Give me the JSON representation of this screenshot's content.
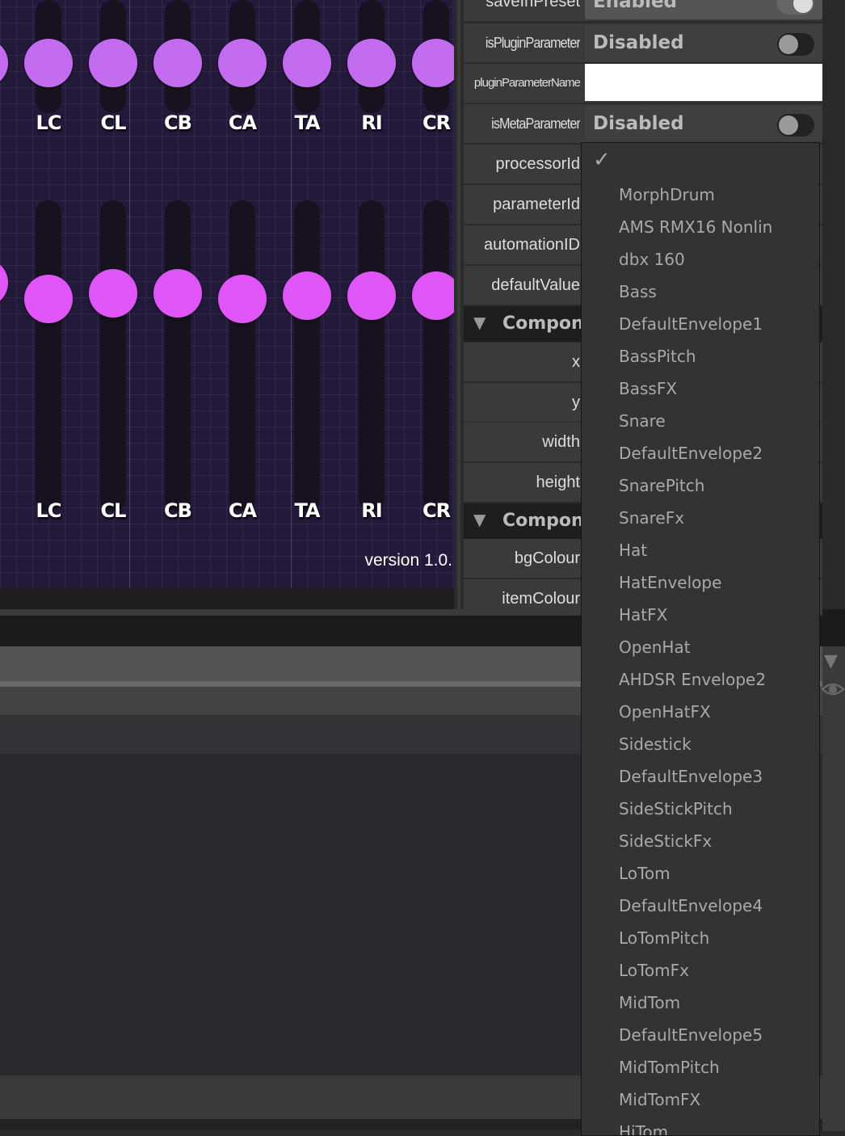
{
  "canvas": {
    "knob_colors": {
      "top": "#c46cf0",
      "bottom": "#e055f8"
    },
    "top_row": {
      "labels": [
        "LC",
        "CL",
        "CB",
        "CA",
        "TA",
        "RI",
        "CR"
      ]
    },
    "bottom_row": {
      "labels": [
        "LC",
        "CL",
        "CB",
        "CA",
        "TA",
        "RI",
        "CR"
      ],
      "values": [
        0.72,
        0.74,
        0.74,
        0.72,
        0.73,
        0.73,
        0.73
      ]
    },
    "version": "version 1.0."
  },
  "properties": {
    "saveInPreset": {
      "label": "saveInPreset",
      "value": "Enabled"
    },
    "isPluginParameter": {
      "label": "isPluginParameter",
      "value": "Disabled"
    },
    "pluginParameterName": {
      "label": "pluginParameterName",
      "value": ""
    },
    "isMetaParameter": {
      "label": "isMetaParameter",
      "value": "Disabled"
    },
    "processorId": {
      "label": "processorId"
    },
    "parameterId": {
      "label": "parameterId"
    },
    "automationID": {
      "label": "automationID"
    },
    "defaultValue": {
      "label": "defaultValue"
    },
    "section1": {
      "title": "Component"
    },
    "x": {
      "label": "x"
    },
    "y": {
      "label": "y"
    },
    "width": {
      "label": "width"
    },
    "height": {
      "label": "height"
    },
    "section2": {
      "title": "Component"
    },
    "bgColour": {
      "label": "bgColour"
    },
    "itemColour": {
      "label": "itemColour"
    }
  },
  "dropdown": {
    "check": "✓",
    "items": [
      "MorphDrum",
      "AMS RMX16 Nonlin",
      "dbx 160",
      "Bass",
      "DefaultEnvelope1",
      "BassPitch",
      "BassFX",
      "Snare",
      "DefaultEnvelope2",
      "SnarePitch",
      "SnareFx",
      "Hat",
      "HatEnvelope",
      "HatFX",
      "OpenHat",
      "AHDSR Envelope2",
      "OpenHatFX",
      "Sidestick",
      "DefaultEnvelope3",
      "SideStickPitch",
      "SideStickFx",
      "LoTom",
      "DefaultEnvelope4",
      "LoTomPitch",
      "LoTomFx",
      "MidTom",
      "DefaultEnvelope5",
      "MidTomPitch",
      "MidTomFX",
      "HiTom"
    ]
  },
  "icons": {
    "collapse": "triangle-down-icon",
    "visibility": "eye-icon"
  }
}
